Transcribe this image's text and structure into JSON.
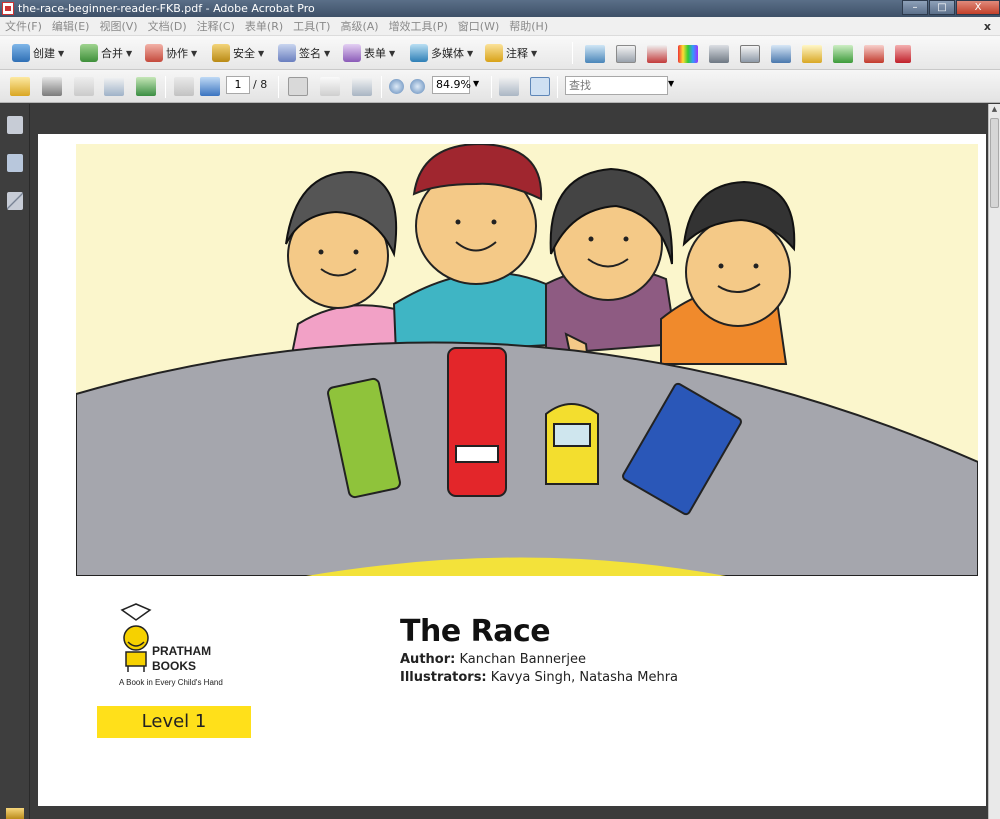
{
  "window": {
    "title": "the-race-beginner-reader-FKB.pdf - Adobe Acrobat Pro",
    "controls": [
      "–",
      "□",
      "X"
    ]
  },
  "menu": {
    "items": [
      "文件(F)",
      "编辑(E)",
      "视图(V)",
      "文档(D)",
      "注释(C)",
      "表单(R)",
      "工具(T)",
      "高级(A)",
      "增效工具(P)",
      "窗口(W)",
      "帮助(H)"
    ],
    "close_symbol": "x"
  },
  "toolbar": {
    "create": "创建",
    "combine": "合并",
    "collaborate": "协作",
    "secure": "安全",
    "sign": "签名",
    "forms": "表单",
    "multimedia": "多媒体",
    "comment": "注释"
  },
  "navigation": {
    "current_page": "1",
    "total_pages": "/ 8",
    "zoom": "84.9%",
    "find_placeholder": "查找"
  },
  "document": {
    "title": "The Race",
    "author_label": "Author:",
    "author": "Kanchan Bannerjee",
    "illustrators_label": "Illustrators:",
    "illustrators": "Kavya Singh, Natasha Mehra",
    "publisher_line1": "PRATHAM",
    "publisher_line2": "BOOKS",
    "publisher_tagline": "A Book in Every Child's Hand",
    "level": "Level 1"
  },
  "colors": {
    "illustration_bg": "#fbf6cc",
    "road": "#a5a6ad",
    "level_badge": "#ffe01a",
    "logo_yellow": "#f6d100"
  }
}
